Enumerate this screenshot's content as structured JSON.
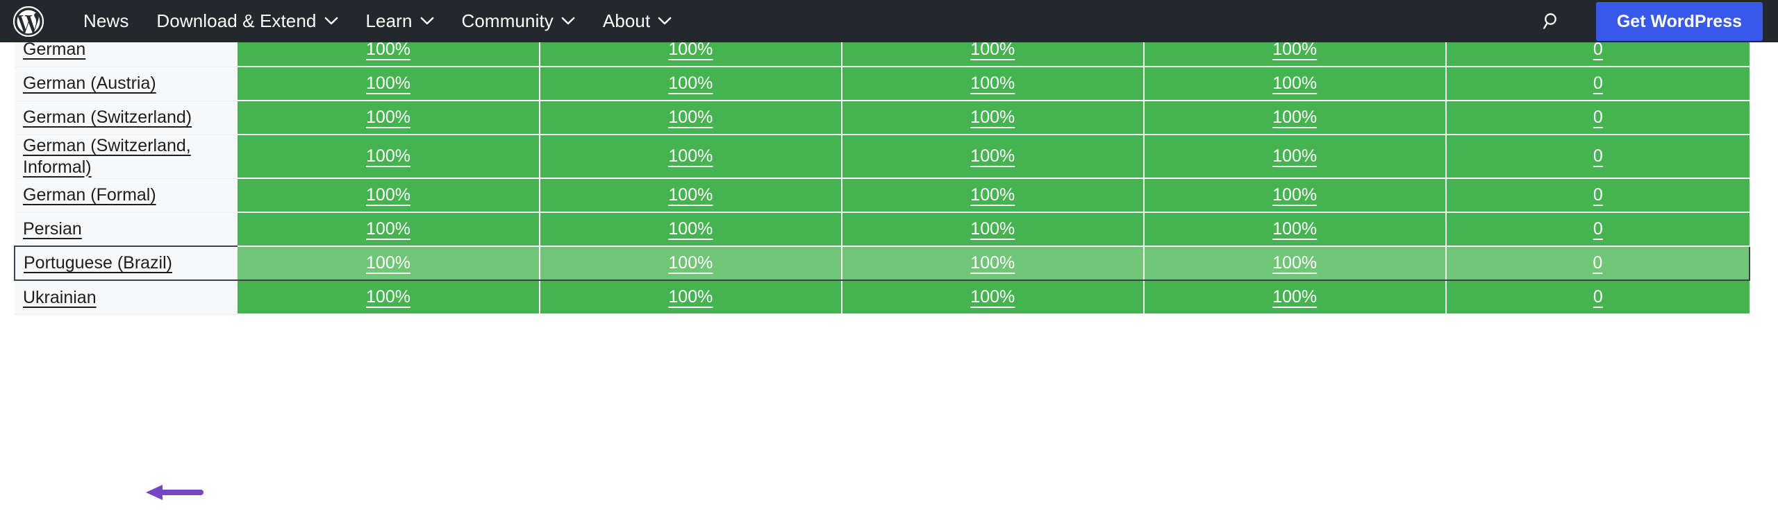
{
  "header": {
    "logo_icon": "wordpress-logo-icon",
    "nav": [
      {
        "label": "News",
        "has_dropdown": false
      },
      {
        "label": "Download & Extend",
        "has_dropdown": true
      },
      {
        "label": "Learn",
        "has_dropdown": true
      },
      {
        "label": "Community",
        "has_dropdown": true
      },
      {
        "label": "About",
        "has_dropdown": true
      }
    ],
    "search_icon": "search-icon",
    "cta_label": "Get WordPress",
    "cta_color": "#3858e9",
    "background_color": "#23282d"
  },
  "table": {
    "green_color": "#45b450",
    "highlight_green_color": "#70c577",
    "name_cell_bg": "#f7f8f9",
    "highlight_border_color": "#3c434a",
    "rows": [
      {
        "name": "German",
        "values": [
          "100%",
          "100%",
          "100%",
          "100%",
          "0"
        ],
        "highlighted": false,
        "tall": false
      },
      {
        "name": "German (Austria)",
        "values": [
          "100%",
          "100%",
          "100%",
          "100%",
          "0"
        ],
        "highlighted": false,
        "tall": false
      },
      {
        "name": "German (Switzerland)",
        "values": [
          "100%",
          "100%",
          "100%",
          "100%",
          "0"
        ],
        "highlighted": false,
        "tall": false
      },
      {
        "name": "German (Switzerland, Informal)",
        "values": [
          "100%",
          "100%",
          "100%",
          "100%",
          "0"
        ],
        "highlighted": false,
        "tall": true
      },
      {
        "name": "German (Formal)",
        "values": [
          "100%",
          "100%",
          "100%",
          "100%",
          "0"
        ],
        "highlighted": false,
        "tall": false
      },
      {
        "name": "Persian",
        "values": [
          "100%",
          "100%",
          "100%",
          "100%",
          "0"
        ],
        "highlighted": false,
        "tall": false
      },
      {
        "name": "Portuguese (Brazil)",
        "values": [
          "100%",
          "100%",
          "100%",
          "100%",
          "0"
        ],
        "highlighted": true,
        "tall": false
      },
      {
        "name": "Ukrainian",
        "values": [
          "100%",
          "100%",
          "100%",
          "100%",
          "0"
        ],
        "highlighted": false,
        "tall": false
      }
    ]
  },
  "annotation": {
    "type": "left-pointing-arrow",
    "color": "#7547c4",
    "points_to": "Portuguese (Brazil)"
  }
}
